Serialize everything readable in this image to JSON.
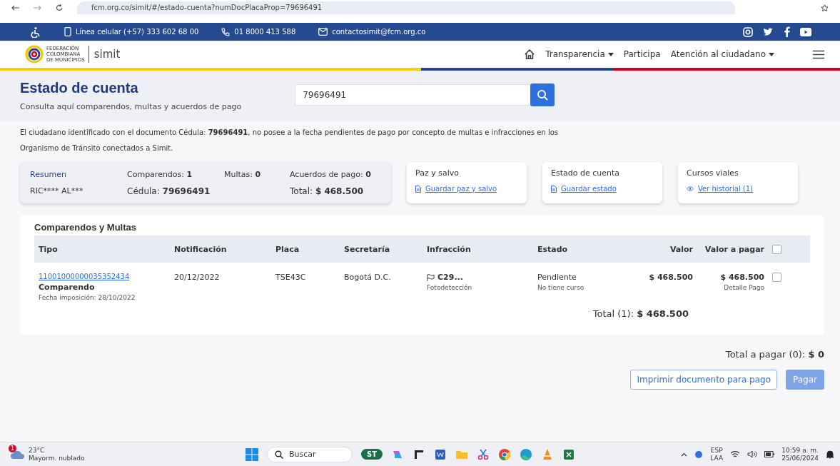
{
  "browser": {
    "url": "fcm.org.co/simit/#/estado-cuenta?numDocPlacaProp=79696491"
  },
  "topbar": {
    "contacts": [
      {
        "kind": "mobile",
        "text": "Línea celular (+57) 333 602 68 00"
      },
      {
        "kind": "phone",
        "text": "01 8000 413 588"
      },
      {
        "kind": "email",
        "text": "contactosimit@fcm.org.co"
      }
    ]
  },
  "nav": {
    "logo_lines": [
      "FEDERACIÓN",
      "COLOMBIANA",
      "DE MUNICIPIOS"
    ],
    "brand": "simit",
    "items": [
      {
        "label": "Transparencia",
        "dropdown": true
      },
      {
        "label": "Participa",
        "dropdown": false
      },
      {
        "label": "Atención al ciudadano",
        "dropdown": true
      }
    ]
  },
  "header": {
    "title": "Estado de cuenta",
    "subtitle": "Consulta aquí comparendos, multas y acuerdos de pago",
    "search_value": "79696491"
  },
  "notice": "El ciudadano identificado con el documento Cédula: **79696491**, no posee a la fecha pendientes de pago por concepto de multas e infracciones en los Organismo de Tránsito conectados a Simit.",
  "summary": {
    "title": "Resumen",
    "name": "RIC**** AL***",
    "stats": [
      "Comparendos: **1**",
      "Multas: **0**",
      "Acuerdos de pago: **0**",
      "Cédula: **79696491**",
      "Total: **$ 468.500**"
    ]
  },
  "cards": [
    {
      "title": "Paz y salvo",
      "link": "Guardar paz y salvo",
      "kind": "document"
    },
    {
      "title": "Estado de cuenta",
      "link": "Guardar estado",
      "kind": "document"
    },
    {
      "title": "Cursos viales",
      "link": "Ver historial (1)",
      "kind": "eye"
    }
  ],
  "table": {
    "title": "Comparendos y Multas",
    "columns": [
      "Tipo",
      "Notificación",
      "Placa",
      "Secretaría",
      "Infracción",
      "Estado",
      "Valor",
      "Valor a pagar"
    ],
    "all_checked": false,
    "rows": [
      {
        "number": "11001000000035352434",
        "type": "Comparendo",
        "date_line": "Fecha imposición: 28/10/2022",
        "notification": "20/12/2022",
        "plate": "TSE43C",
        "office": "Bogotá D.C.",
        "infraction": "C29...",
        "infraction_note": "Fotodetección",
        "status": "Pendiente",
        "status_note": "No tiene curso",
        "value": "$ 468.500",
        "to_pay": "$ 468.500",
        "to_pay_note": "Detalle Pago",
        "checked": false
      }
    ],
    "total": "Total (1): **$ 468.500**"
  },
  "pay_total": "Total a pagar (0): **$ 0**",
  "buttons": [
    "Imprimir documento para pago",
    "Pagar"
  ],
  "taskbar": {
    "badge": "1",
    "temperature": "23°C",
    "weather": "Mayorm. nublado",
    "search_placeholder": "Buscar",
    "app_label": "ST",
    "lang": "ESP",
    "layout": "LAA",
    "time": "10:59 a. m.",
    "date": "25/06/2024"
  }
}
